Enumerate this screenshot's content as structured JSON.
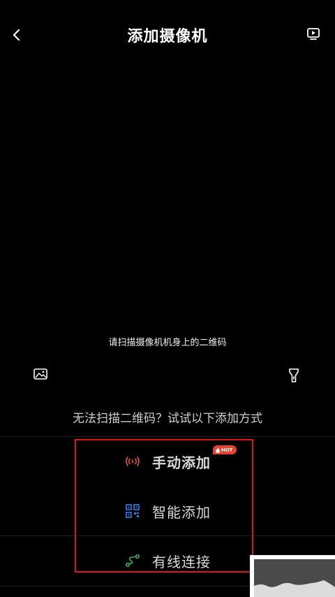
{
  "header": {
    "title": "添加摄像机",
    "back_icon": "chevron-left-icon",
    "video_icon": "video-play-icon"
  },
  "scanner": {
    "hint": "请扫描摄像机机身上的二维码",
    "album_icon": "image-icon",
    "flash_icon": "flashlight-icon"
  },
  "alternatives": {
    "prompt": "无法扫描二维码？试试以下添加方式",
    "options": [
      {
        "label": "手动添加",
        "icon": "wireless-signal-icon",
        "icon_color": "#e8563f",
        "badge": "HOT"
      },
      {
        "label": "智能添加",
        "icon": "qr-code-icon",
        "icon_color": "#2f7fe8"
      },
      {
        "label": "有线连接",
        "icon": "cable-icon",
        "icon_color": "#3cb55a"
      }
    ]
  },
  "colors": {
    "background": "#000000",
    "highlight_border": "#d8161c",
    "badge": "#e8412f"
  }
}
